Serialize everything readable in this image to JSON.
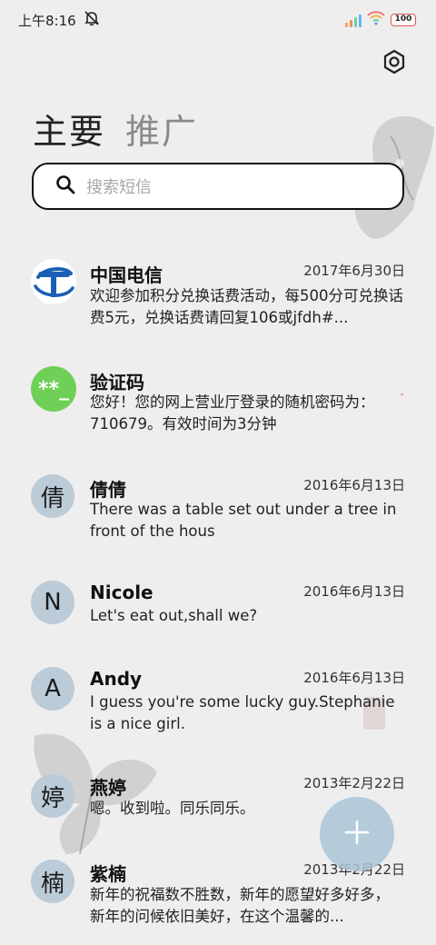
{
  "status_bar": {
    "time": "上午8:16",
    "battery": "100"
  },
  "tabs": [
    {
      "label": "主要"
    },
    {
      "label": "推广"
    }
  ],
  "search": {
    "placeholder": "搜索短信"
  },
  "messages": [
    {
      "name": "中国电信",
      "date": "2017年6月30日",
      "preview": "欢迎参加积分兑换话费活动，每500分可兑换话费5元，兑换话费请回复106或jfdh#...",
      "avatar_type": "telecom-logo"
    },
    {
      "name": "验证码",
      "date": "",
      "preview": "您好！您的网上营业厅登录的随机密码为：710679。有效时间为3分钟",
      "avatar_text": "**_",
      "avatar_type": "code"
    },
    {
      "name": "倩倩",
      "date": "2016年6月13日",
      "preview": "There was a table set out under a tree in front of the hous",
      "avatar_text": "倩"
    },
    {
      "name": "Nicole",
      "date": "2016年6月13日",
      "preview": "Let's eat out,shall we?",
      "avatar_text": "N"
    },
    {
      "name": "Andy",
      "date": "2016年6月13日",
      "preview": "I guess you're some lucky guy.Stephanie is a nice girl.",
      "avatar_text": "A"
    },
    {
      "name": "燕婷",
      "date": "2013年2月22日",
      "preview": "嗯。收到啦。同乐同乐。",
      "avatar_text": "婷"
    },
    {
      "name": "紫楠",
      "date": "2013年2月22日",
      "preview": "新年的祝福数不胜数，新年的愿望好多好多，新年的问候依旧美好，在这个温馨的...",
      "avatar_text": "楠"
    }
  ],
  "colors": {
    "background": "#eeeeee",
    "avatar": "#bccbd8",
    "code_avatar": "#6fd057",
    "fab": "#aac4d6"
  },
  "icons": {
    "settings": "gear-icon",
    "search": "search-icon",
    "fab": "plus-icon",
    "mute": "bell-off-icon",
    "signal": "signal-icon",
    "wifi": "wifi-icon",
    "battery": "battery-icon"
  }
}
